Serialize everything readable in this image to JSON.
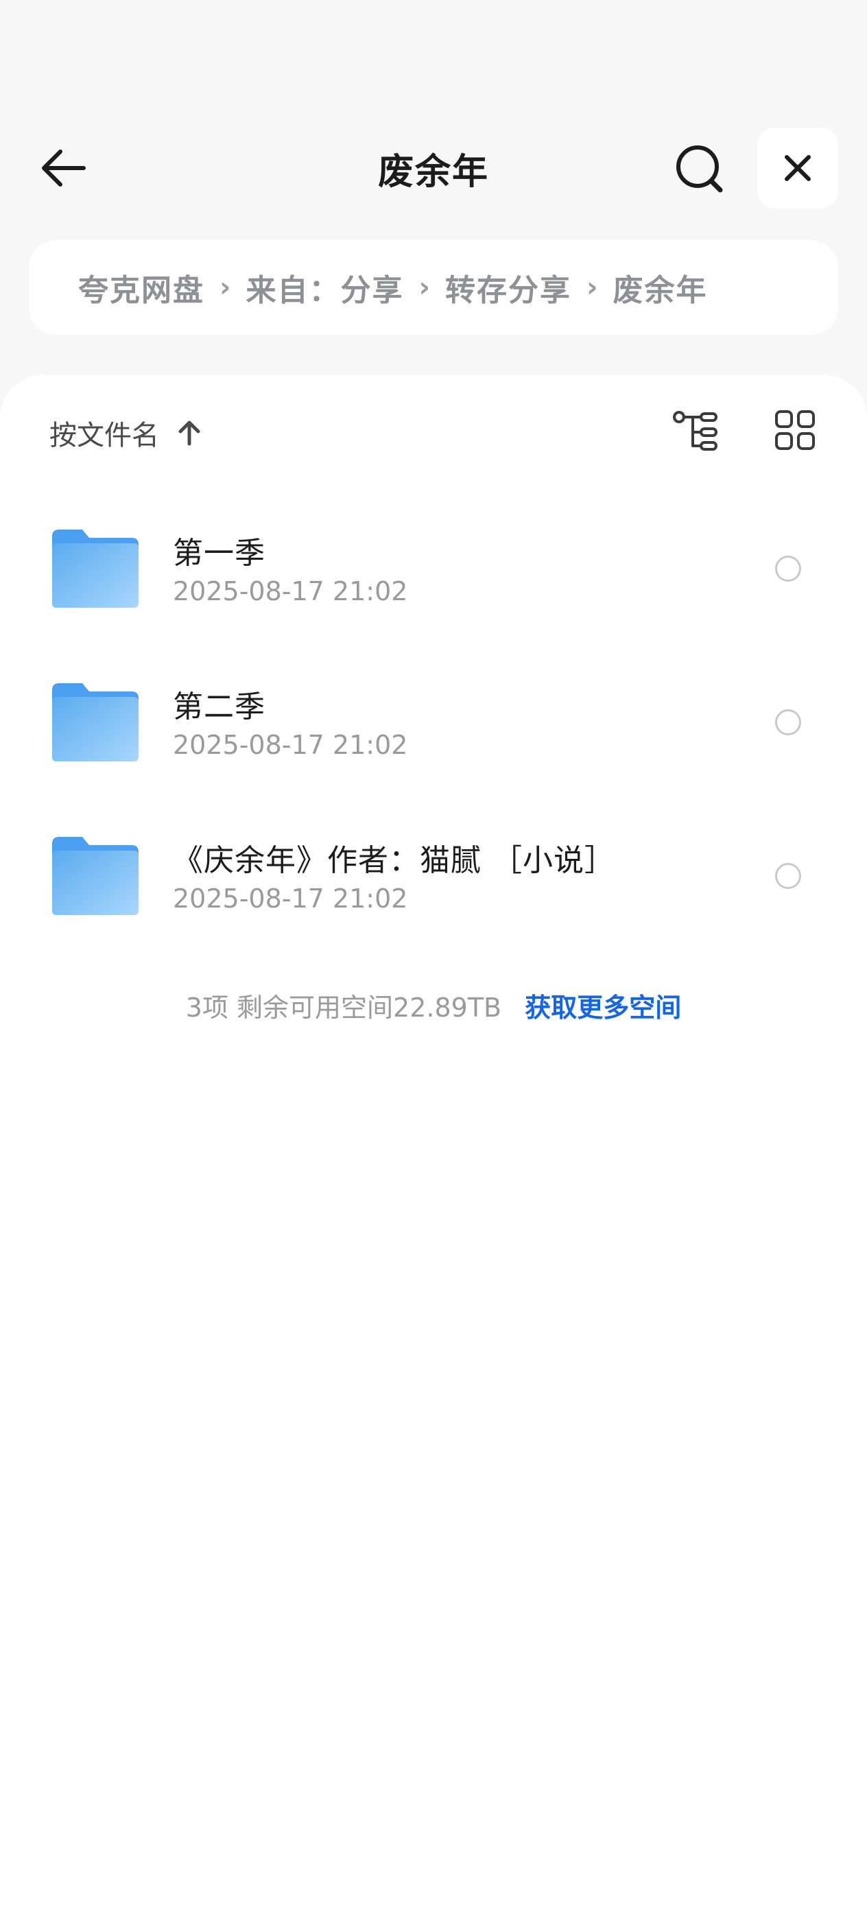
{
  "header": {
    "title": "废余年",
    "back_icon": "arrow-left-icon",
    "search_icon": "search-icon",
    "close_icon": "close-icon"
  },
  "breadcrumb": {
    "items": [
      "夸克网盘",
      "来自：分享",
      "转存分享",
      "废余年"
    ],
    "separator": "›"
  },
  "toolbar": {
    "sort_label": "按文件名",
    "sort_icon": "arrow-up-icon",
    "tree_icon": "tree-view-icon",
    "grid_icon": "grid-view-icon"
  },
  "files": [
    {
      "name": "第一季",
      "date": "2025-08-17 21:02",
      "icon": "folder-icon"
    },
    {
      "name": "第二季",
      "date": "2025-08-17 21:02",
      "icon": "folder-icon"
    },
    {
      "name": "《庆余年》作者：猫腻 ［小说］",
      "date": "2025-08-17 21:02",
      "icon": "folder-icon"
    }
  ],
  "footer": {
    "info": "3项 剩余可用空间22.89TB",
    "link": "获取更多空间"
  },
  "colors": {
    "background": "#f7f7f8",
    "panel": "#ffffff",
    "link": "#1565e0",
    "folder": "#5aacf0"
  }
}
